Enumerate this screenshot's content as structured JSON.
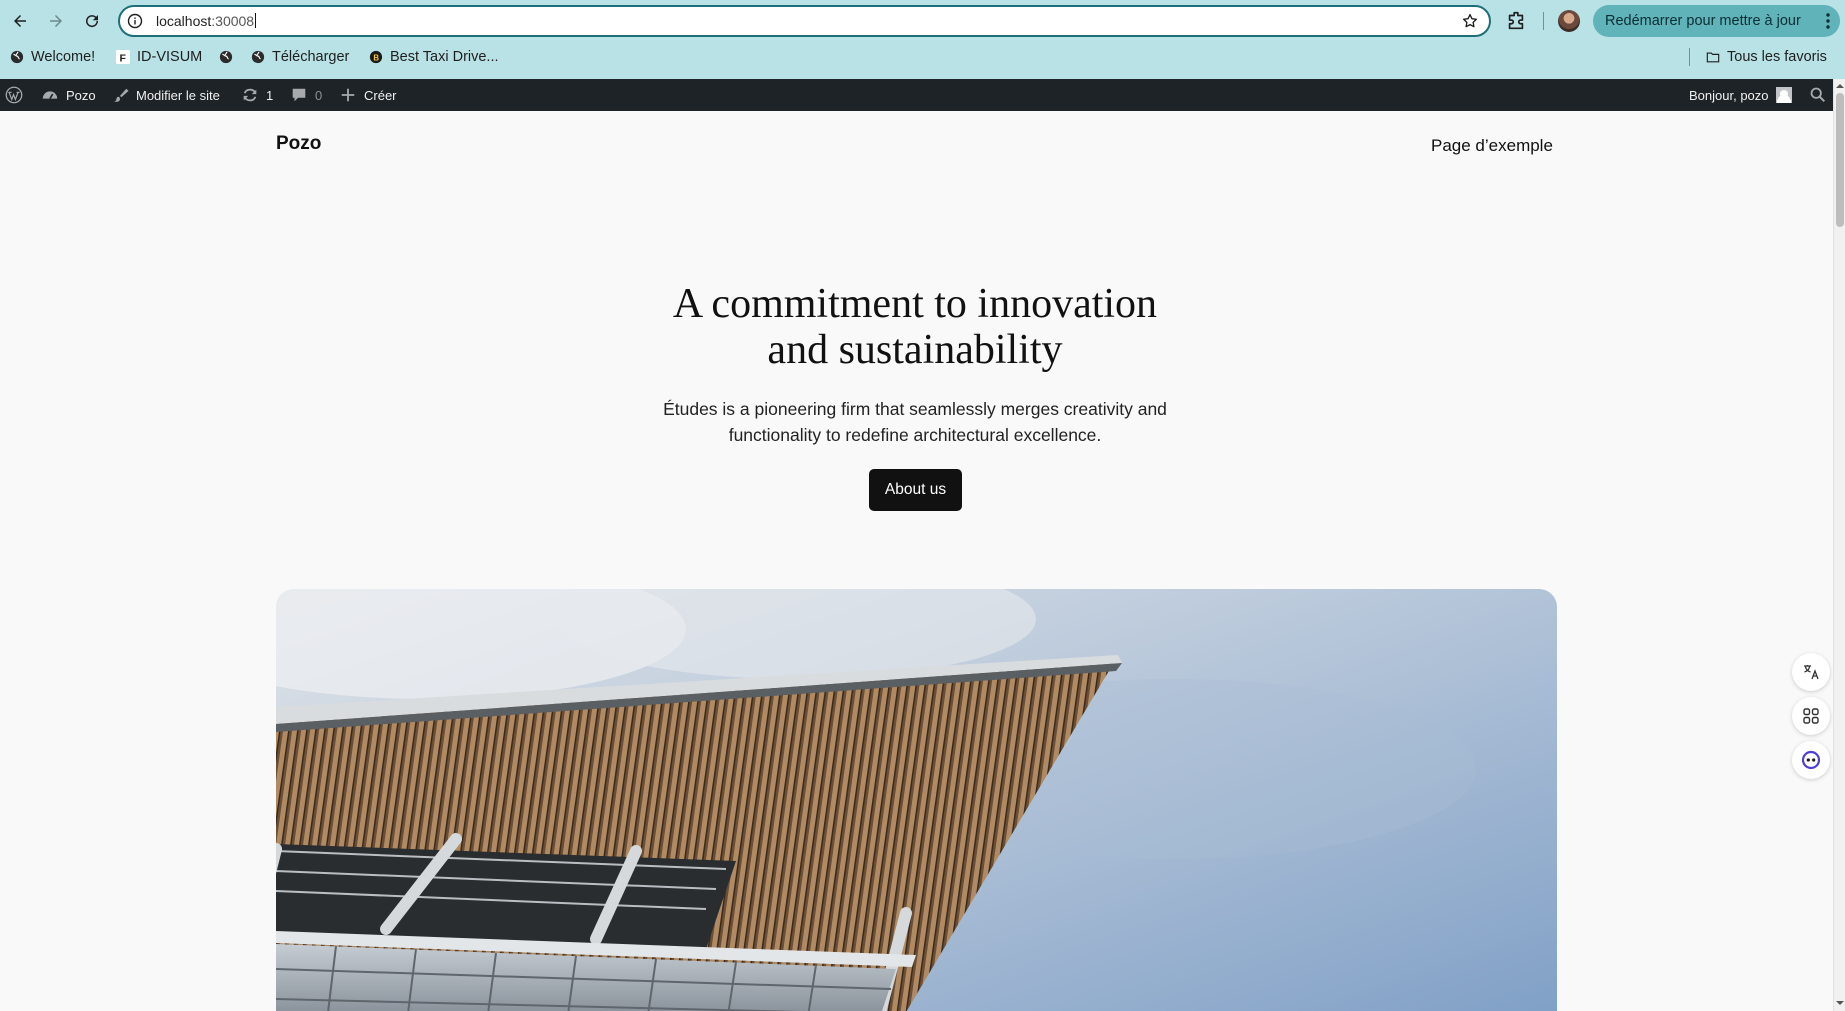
{
  "browser": {
    "url_host": "localhost",
    "url_port": ":30008",
    "update_button": "Redémarrer pour mettre à jour",
    "bookmarks": [
      {
        "label": "Welcome!",
        "icon": "globe-icon"
      },
      {
        "label": "ID-VISUM",
        "icon": "f-favicon-icon"
      },
      {
        "label": "",
        "icon": "globe-icon"
      },
      {
        "label": "Télécharger",
        "icon": "globe-icon"
      },
      {
        "label": "Best Taxi Drive...",
        "icon": "b-favicon-icon"
      }
    ],
    "all_bookmarks": "Tous les favoris"
  },
  "adminbar": {
    "site_name": "Pozo",
    "edit_site": "Modifier le site",
    "updates_count": "1",
    "comments_count": "0",
    "new": "Créer",
    "greeting": "Bonjour, pozo"
  },
  "site": {
    "title": "Pozo",
    "nav_link": "Page d’exemple"
  },
  "hero": {
    "title_line1": "A commitment to innovation",
    "title_line2": "and sustainability",
    "text_line1": "Études is a pioneering firm that seamlessly merges creativity and",
    "text_line2": "functionality to redefine architectural excellence.",
    "button": "About us"
  },
  "colors": {
    "chrome_bg": "#b8e2e6",
    "update_button": "#5fb3b9",
    "adminbar_bg": "#1d2327",
    "page_bg": "#f9f9f9",
    "button_bg": "#111111"
  }
}
